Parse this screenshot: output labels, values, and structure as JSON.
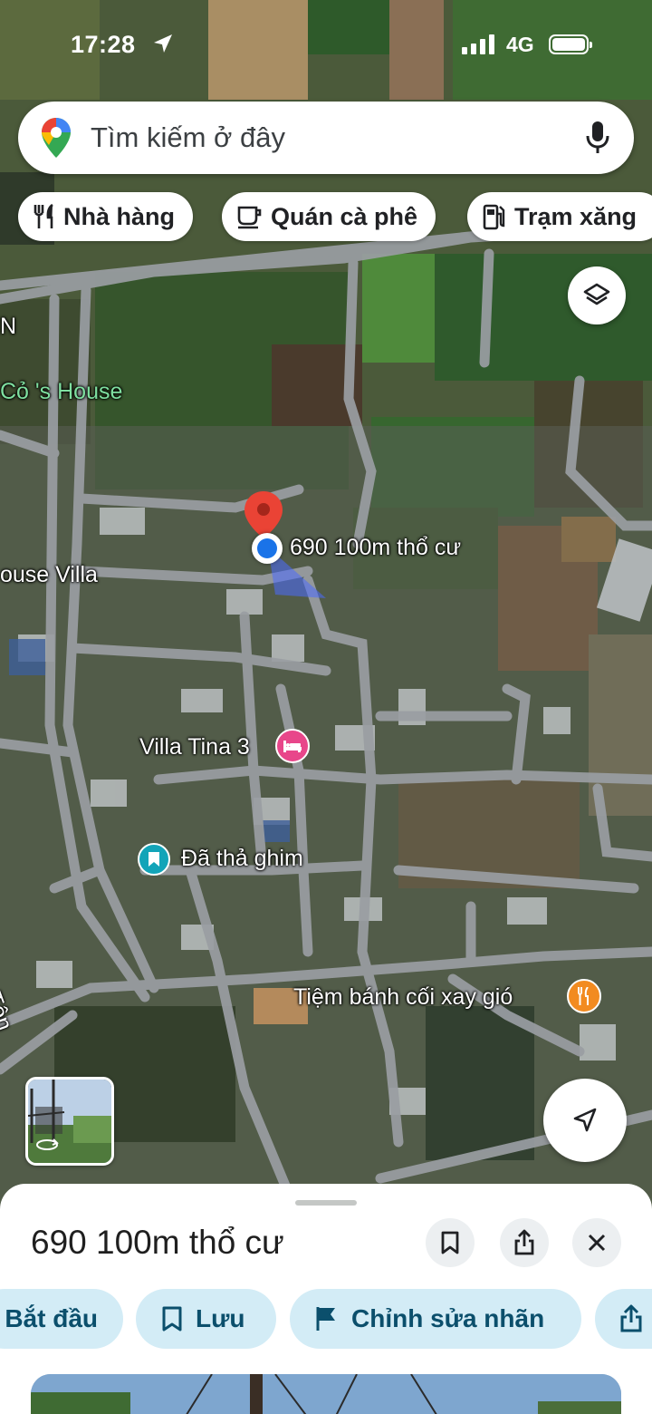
{
  "status_bar": {
    "time": "17:28",
    "network": "4G"
  },
  "search": {
    "placeholder": "Tìm kiếm ở đây"
  },
  "chips": [
    {
      "label": "Nhà hàng",
      "icon": "restaurant-icon"
    },
    {
      "label": "Quán cà phê",
      "icon": "cafe-icon"
    },
    {
      "label": "Trạm xăng",
      "icon": "gas-station-icon"
    }
  ],
  "map_labels": {
    "letter_n": "N",
    "co_house": "Cỏ 's House",
    "house_villa": "ouse Villa",
    "selected_place": "690 100m thổ cư",
    "villa_tina": "Villa Tina 3",
    "pinned": "Đã thả ghim",
    "bakery": "Tiệm bánh cối xay gió",
    "street": "Đức Tôn"
  },
  "sheet": {
    "title": "690 100m thổ cư",
    "actions": [
      {
        "label": "Bắt đầu"
      },
      {
        "label": "Lưu",
        "icon": "bookmark-icon"
      },
      {
        "label": "Chỉnh sửa nhãn",
        "icon": "flag-icon"
      },
      {
        "label": "",
        "icon": "share-icon"
      }
    ]
  },
  "colors": {
    "accent": "#0b57d0",
    "chip_action_bg": "#d3ecf6",
    "pin_red": "#ea4335",
    "hotel_pink": "#e8468a",
    "restaurant_orange": "#f28b20",
    "pinned_teal": "#12a4b8"
  }
}
